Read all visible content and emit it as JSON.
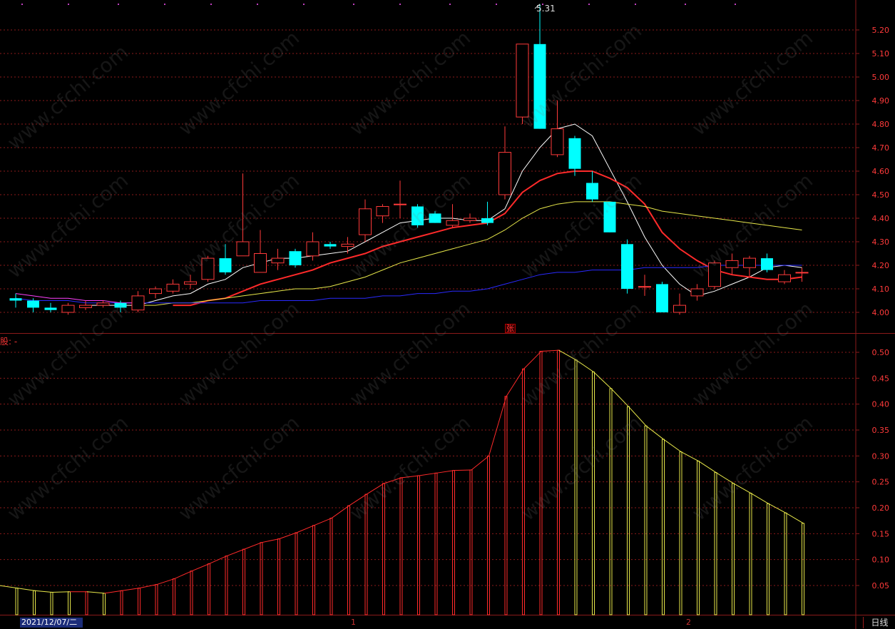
{
  "ui": {
    "period": "日线",
    "start_date": "2021/12/07/二",
    "month_labels": [
      "1",
      "2"
    ],
    "indicator_name": "股: -",
    "peak_label": "5.31",
    "limit_up_mark": "张",
    "watermark": "www.cfchi.com",
    "colors": {
      "background": "#000000",
      "grid": "#8b1a1a",
      "up": "#ff3a3a",
      "down": "#00ffff"
    }
  },
  "chart_data": [
    {
      "type": "candlestick",
      "title": "",
      "y_ticks": [
        "5.20",
        "5.10",
        "5.00",
        "4.90",
        "4.80",
        "4.70",
        "4.60",
        "4.50",
        "4.40",
        "4.30",
        "4.20",
        "4.10",
        "4.00"
      ],
      "ylim": [
        3.96,
        5.31
      ],
      "candles": [
        {
          "o": 4.06,
          "h": 4.08,
          "l": 4.02,
          "c": 4.05
        },
        {
          "o": 4.05,
          "h": 4.06,
          "l": 4.0,
          "c": 4.02
        },
        {
          "o": 4.02,
          "h": 4.04,
          "l": 4.0,
          "c": 4.01
        },
        {
          "o": 4.0,
          "h": 4.04,
          "l": 3.99,
          "c": 4.03
        },
        {
          "o": 4.02,
          "h": 4.05,
          "l": 4.01,
          "c": 4.03
        },
        {
          "o": 4.03,
          "h": 4.05,
          "l": 4.02,
          "c": 4.04
        },
        {
          "o": 4.04,
          "h": 4.05,
          "l": 4.0,
          "c": 4.02
        },
        {
          "o": 4.01,
          "h": 4.09,
          "l": 4.0,
          "c": 4.07
        },
        {
          "o": 4.08,
          "h": 4.11,
          "l": 4.06,
          "c": 4.1
        },
        {
          "o": 4.09,
          "h": 4.14,
          "l": 4.08,
          "c": 4.12
        },
        {
          "o": 4.12,
          "h": 4.16,
          "l": 4.1,
          "c": 4.13
        },
        {
          "o": 4.14,
          "h": 4.24,
          "l": 4.13,
          "c": 4.23
        },
        {
          "o": 4.23,
          "h": 4.29,
          "l": 4.16,
          "c": 4.17
        },
        {
          "o": 4.24,
          "h": 4.59,
          "l": 4.24,
          "c": 4.3
        },
        {
          "o": 4.17,
          "h": 4.35,
          "l": 4.17,
          "c": 4.25
        },
        {
          "o": 4.21,
          "h": 4.27,
          "l": 4.18,
          "c": 4.23
        },
        {
          "o": 4.26,
          "h": 4.27,
          "l": 4.19,
          "c": 4.2
        },
        {
          "o": 4.24,
          "h": 4.34,
          "l": 4.22,
          "c": 4.3
        },
        {
          "o": 4.29,
          "h": 4.3,
          "l": 4.27,
          "c": 4.28
        },
        {
          "o": 4.28,
          "h": 4.32,
          "l": 4.25,
          "c": 4.29
        },
        {
          "o": 4.33,
          "h": 4.48,
          "l": 4.3,
          "c": 4.44
        },
        {
          "o": 4.41,
          "h": 4.46,
          "l": 4.38,
          "c": 4.45
        },
        {
          "o": 4.46,
          "h": 4.56,
          "l": 4.4,
          "c": 4.46
        },
        {
          "o": 4.45,
          "h": 4.46,
          "l": 4.36,
          "c": 4.37
        },
        {
          "o": 4.42,
          "h": 4.43,
          "l": 4.38,
          "c": 4.38
        },
        {
          "o": 4.37,
          "h": 4.46,
          "l": 4.36,
          "c": 4.39
        },
        {
          "o": 4.39,
          "h": 4.42,
          "l": 4.38,
          "c": 4.4
        },
        {
          "o": 4.4,
          "h": 4.47,
          "l": 4.37,
          "c": 4.38
        },
        {
          "o": 4.5,
          "h": 4.79,
          "l": 4.48,
          "c": 4.68
        },
        {
          "o": 4.83,
          "h": 5.14,
          "l": 4.8,
          "c": 5.14
        },
        {
          "o": 5.14,
          "h": 5.31,
          "l": 4.78,
          "c": 4.78
        },
        {
          "o": 4.67,
          "h": 4.9,
          "l": 4.66,
          "c": 4.78
        },
        {
          "o": 4.74,
          "h": 4.75,
          "l": 4.58,
          "c": 4.61
        },
        {
          "o": 4.55,
          "h": 4.6,
          "l": 4.47,
          "c": 4.48
        },
        {
          "o": 4.47,
          "h": 4.47,
          "l": 4.34,
          "c": 4.34
        },
        {
          "o": 4.29,
          "h": 4.31,
          "l": 4.08,
          "c": 4.1
        },
        {
          "o": 4.11,
          "h": 4.16,
          "l": 4.07,
          "c": 4.11
        },
        {
          "o": 4.12,
          "h": 4.13,
          "l": 4.0,
          "c": 4.0
        },
        {
          "o": 4.0,
          "h": 4.08,
          "l": 3.99,
          "c": 4.03
        },
        {
          "o": 4.07,
          "h": 4.12,
          "l": 4.05,
          "c": 4.1
        },
        {
          "o": 4.11,
          "h": 4.22,
          "l": 4.1,
          "c": 4.21
        },
        {
          "o": 4.19,
          "h": 4.25,
          "l": 4.16,
          "c": 4.22
        },
        {
          "o": 4.19,
          "h": 4.24,
          "l": 4.15,
          "c": 4.23
        },
        {
          "o": 4.23,
          "h": 4.25,
          "l": 4.17,
          "c": 4.18
        },
        {
          "o": 4.13,
          "h": 4.18,
          "l": 4.12,
          "c": 4.16
        },
        {
          "o": 4.17,
          "h": 4.19,
          "l": 4.13,
          "c": 4.17
        }
      ],
      "ma": [
        {
          "color": "#ffffff",
          "values": [
            null,
            null,
            null,
            null,
            4.03,
            4.03,
            4.03,
            4.03,
            4.05,
            4.07,
            4.08,
            4.12,
            4.14,
            4.19,
            4.21,
            4.23,
            4.23,
            4.24,
            4.25,
            4.26,
            4.3,
            4.34,
            4.38,
            4.39,
            4.4,
            4.4,
            4.39,
            4.39,
            4.44,
            4.6,
            4.7,
            4.78,
            4.8,
            4.75,
            4.61,
            4.47,
            4.32,
            4.2,
            4.12,
            4.07,
            4.09,
            4.12,
            4.15,
            4.19,
            4.2,
            4.19
          ]
        },
        {
          "color": "#ff2a2a",
          "values": [
            null,
            null,
            null,
            null,
            null,
            null,
            null,
            null,
            null,
            4.03,
            4.03,
            4.05,
            4.06,
            4.09,
            4.12,
            4.14,
            4.16,
            4.18,
            4.21,
            4.23,
            4.25,
            4.28,
            4.3,
            4.32,
            4.34,
            4.36,
            4.37,
            4.38,
            4.42,
            4.51,
            4.56,
            4.59,
            4.6,
            4.6,
            4.57,
            4.53,
            4.46,
            4.34,
            4.27,
            4.22,
            4.18,
            4.16,
            4.15,
            4.14,
            4.14,
            4.15
          ]
        },
        {
          "color": "#e8e84a",
          "values": [
            null,
            null,
            null,
            null,
            null,
            null,
            null,
            4.03,
            4.03,
            4.04,
            4.04,
            4.05,
            4.06,
            4.07,
            4.08,
            4.09,
            4.1,
            4.1,
            4.11,
            4.13,
            4.15,
            4.18,
            4.21,
            4.23,
            4.25,
            4.27,
            4.29,
            4.31,
            4.35,
            4.4,
            4.44,
            4.46,
            4.47,
            4.47,
            4.47,
            4.46,
            4.45,
            4.43,
            4.42,
            4.41,
            4.4,
            4.39,
            4.38,
            4.37,
            4.36,
            4.35
          ]
        },
        {
          "color": "#2a2aff",
          "values": [
            4.06,
            4.05,
            4.05,
            4.05,
            4.04,
            4.04,
            4.04,
            4.04,
            4.04,
            4.04,
            4.04,
            4.04,
            4.04,
            4.04,
            4.05,
            4.05,
            4.05,
            4.05,
            4.06,
            4.06,
            4.06,
            4.07,
            4.07,
            4.08,
            4.08,
            4.09,
            4.09,
            4.1,
            4.12,
            4.14,
            4.16,
            4.17,
            4.17,
            4.18,
            4.18,
            4.18,
            4.19,
            4.19,
            4.19,
            4.19,
            4.2,
            4.2,
            4.2,
            4.2,
            4.2,
            4.2
          ]
        },
        {
          "color": "#ff40ff",
          "values": [
            4.08,
            4.07,
            4.06,
            4.06,
            4.05,
            4.05,
            4.04,
            4.04,
            null,
            null,
            null,
            null,
            null,
            null,
            null,
            null,
            null,
            null,
            null,
            null,
            null,
            null,
            null,
            null,
            null,
            null,
            null,
            null,
            null,
            null,
            null,
            null,
            null,
            null,
            null,
            null,
            null,
            null,
            null,
            null,
            null,
            null,
            null,
            null,
            null,
            null
          ]
        }
      ]
    },
    {
      "type": "bar",
      "title": "",
      "y_ticks": [
        "0.50",
        "0.45",
        "0.40",
        "0.35",
        "0.30",
        "0.25",
        "0.20",
        "0.15",
        "0.10",
        "0.05"
      ],
      "ylim": [
        0,
        0.52
      ],
      "values": [
        0.05,
        0.045,
        0.04,
        0.037,
        0.038,
        0.038,
        0.035,
        0.04,
        0.045,
        0.052,
        0.063,
        0.078,
        0.092,
        0.107,
        0.12,
        0.133,
        0.14,
        0.152,
        0.166,
        0.18,
        0.204,
        0.226,
        0.247,
        0.258,
        0.262,
        0.267,
        0.272,
        0.273,
        0.3,
        0.415,
        0.468,
        0.502,
        0.504,
        0.485,
        0.462,
        0.43,
        0.395,
        0.358,
        0.332,
        0.308,
        0.29,
        0.268,
        0.247,
        0.228,
        0.208,
        0.19,
        0.17
      ],
      "colors": [
        "#e8e84a",
        "#e8e84a",
        "#e8e84a",
        "#e8e84a",
        "#e8e84a",
        "#ff2a2a",
        "#e8e84a",
        "#ff2a2a",
        "#ff2a2a",
        "#ff2a2a",
        "#ff2a2a",
        "#ff2a2a",
        "#ff2a2a",
        "#ff2a2a",
        "#ff2a2a",
        "#ff2a2a",
        "#ff2a2a",
        "#ff2a2a",
        "#ff2a2a",
        "#ff2a2a",
        "#ff2a2a",
        "#ff2a2a",
        "#ff2a2a",
        "#ff2a2a",
        "#ff2a2a",
        "#ff2a2a",
        "#ff2a2a",
        "#ff2a2a",
        "#ff2a2a",
        "#ff2a2a",
        "#ff2a2a",
        "#ff2a2a",
        "#ff2a2a",
        "#e8e84a",
        "#e8e84a",
        "#e8e84a",
        "#e8e84a",
        "#e8e84a",
        "#e8e84a",
        "#e8e84a",
        "#e8e84a",
        "#e8e84a",
        "#e8e84a",
        "#e8e84a",
        "#e8e84a",
        "#e8e84a",
        "#e8e84a"
      ]
    }
  ]
}
